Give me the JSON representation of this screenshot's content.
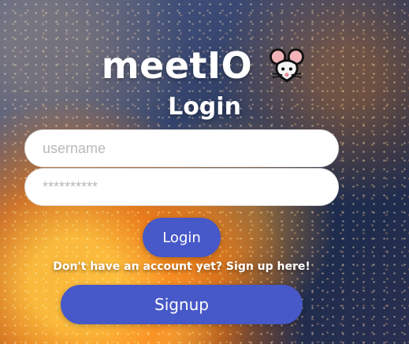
{
  "brand": {
    "title": "meetIO",
    "icon": "mouse-face-icon"
  },
  "login": {
    "heading": "Login"
  },
  "form": {
    "username_placeholder": "username",
    "password_placeholder": "**********"
  },
  "actions": {
    "login_label": "Login",
    "signup_hint": "Don't have an account yet? Sign up here!",
    "signup_label": "Signup"
  },
  "theme": {
    "primary_button_color": "#4758c8",
    "input_background": "#ffffff",
    "heading_color": "#ffffff"
  }
}
